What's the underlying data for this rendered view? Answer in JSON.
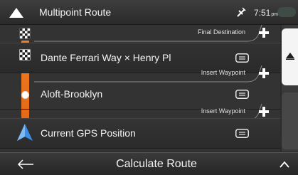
{
  "statusbar": {
    "title": "Multipoint Route",
    "time": "7:51",
    "ampm": "pm"
  },
  "route": {
    "insert_final_label": "Final Destination",
    "destination_label": "Dante Ferrari Way × Henry Pl",
    "insert_waypoint_1_label": "Insert Waypoint",
    "waypoint_label": "Aloft-Brooklyn",
    "insert_waypoint_2_label": "Insert Waypoint",
    "start_label": "Current GPS Position"
  },
  "bottombar": {
    "calculate_label": "Calculate Route"
  },
  "colors": {
    "route_orange": "#f07f22",
    "gps_blue": "#3a8ee6",
    "background": "#2b2b2b"
  },
  "icons": [
    "nav-triangle-icon",
    "gps-satellite-icon",
    "checkered-flag-icon",
    "waypoint-dot-icon",
    "gps-arrow-icon",
    "note-icon",
    "plus-icon",
    "scroll-up-icon",
    "back-arrow-icon",
    "expand-up-icon"
  ]
}
